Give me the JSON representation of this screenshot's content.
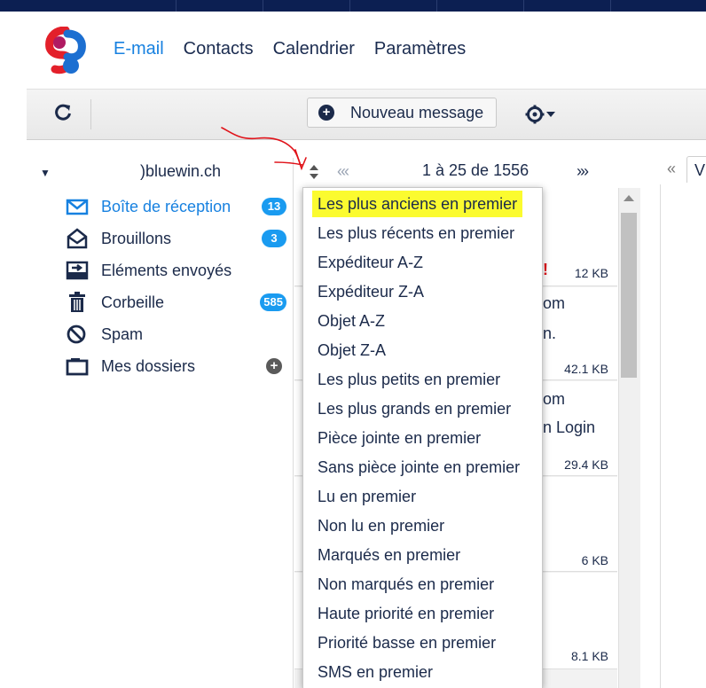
{
  "nav": {
    "email": "E-mail",
    "contacts": "Contacts",
    "calendar": "Calendrier",
    "settings": "Paramètres"
  },
  "toolbar": {
    "new_message": "Nouveau message"
  },
  "account": {
    "email_suffix": ")bluewin.ch"
  },
  "folders": [
    {
      "name": "Boîte de réception",
      "badge": "13",
      "icon": "inbox-icon"
    },
    {
      "name": "Brouillons",
      "badge": "3",
      "icon": "drafts-icon"
    },
    {
      "name": "Eléments envoyés",
      "badge": "",
      "icon": "sent-icon"
    },
    {
      "name": "Corbeille",
      "badge": "585",
      "icon": "trash-icon"
    },
    {
      "name": "Spam",
      "badge": "",
      "icon": "spam-icon"
    },
    {
      "name": "Mes dossiers",
      "badge": "",
      "icon": "folder-icon"
    }
  ],
  "pager": {
    "prev": "«‹",
    "text": "1 à 25 de 1556",
    "next": "›»"
  },
  "sort_menu": [
    "Les plus anciens en premier",
    "Les plus récents en premier",
    "Expéditeur A-Z",
    "Expéditeur Z-A",
    "Objet A-Z",
    "Objet Z-A",
    "Les plus petits en premier",
    "Les plus grands en premier",
    "Pièce jointe en premier",
    "Sans pièce jointe en premier",
    "Lu en premier",
    "Non lu en premier",
    "Marqués en premier",
    "Non marqués en premier",
    "Haute priorité en premier",
    "Priorité basse en premier",
    "SMS en premier"
  ],
  "messages_visible": {
    "sizes": [
      "12 KB",
      "42.1 KB",
      "29.4 KB",
      "6 KB",
      "8.1 KB"
    ],
    "peek_texts": [
      "!",
      "om",
      "n.",
      "om",
      "n Login"
    ]
  },
  "reading_pane": {
    "collapse": "«",
    "tab": "V"
  },
  "colors": {
    "accent": "#1781e0",
    "badge": "#1a9bf0",
    "highlight": "#fbfb2f",
    "topbar": "#0c1f52",
    "annotation": "#e0131a"
  }
}
